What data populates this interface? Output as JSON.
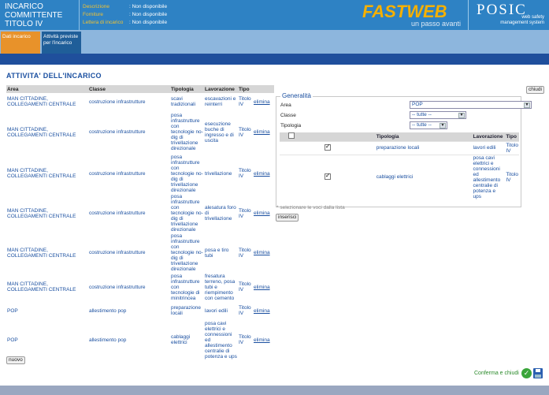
{
  "header": {
    "title_lines": [
      "INCARICO",
      "COMMITTENTE",
      "TITOLO IV"
    ],
    "meta": [
      {
        "label": "Descrizione",
        "value": ": Non disponibile"
      },
      {
        "label": "Forniture",
        "value": ": Non disponibile"
      },
      {
        "label": "Lettera di incarico",
        "value": ": Non disponibile"
      }
    ],
    "logo_word": "FASTWEB",
    "logo_slogan": "un passo avanti",
    "posic_name": "POSIC",
    "posic_sub_1": "web safety",
    "posic_sub_2": "management system"
  },
  "tabs": [
    {
      "label": "Dati incarico"
    },
    {
      "label": "Attività previste per l'incarico"
    }
  ],
  "page_title": "ATTIVITA' DELL'INCARICO",
  "activities": {
    "headers": [
      "Area",
      "Classe",
      "Tipologia",
      "Lavorazione",
      "Tipo",
      ""
    ],
    "rows": [
      {
        "area": "MAN CITTADINE, COLLEGAMENTI CENTRALE",
        "classe": "costruzione infrastrutture",
        "tipologia": "scavi tradizionali",
        "lavorazione": "escavazioni e reinterri",
        "tipo": "Titolo IV",
        "azione": "elimina"
      },
      {
        "area": "MAN CITTADINE, COLLEGAMENTI CENTRALE",
        "classe": "costruzione infrastrutture",
        "tipologia": "posa infrastrutture con tecnologie no-dig di trivellazione direzionale",
        "lavorazione": "esecuzione buche di ingresso e di uscita",
        "tipo": "Titolo IV",
        "azione": "elimina"
      },
      {
        "area": "MAN CITTADINE, COLLEGAMENTI CENTRALE",
        "classe": "costruzione infrastrutture",
        "tipologia": "posa infrastrutture con tecnologie no-dig di trivellazione direzionale",
        "lavorazione": "trivellazione",
        "tipo": "Titolo IV",
        "azione": "elimina"
      },
      {
        "area": "MAN CITTADINE, COLLEGAMENTI CENTRALE",
        "classe": "costruzione infrastrutture",
        "tipologia": "posa infrastrutture con tecnologie no-dig di trivellazione direzionale",
        "lavorazione": "alesatura foro di trivellazione",
        "tipo": "Titolo IV",
        "azione": "elimina"
      },
      {
        "area": "MAN CITTADINE, COLLEGAMENTI CENTRALE",
        "classe": "costruzione infrastrutture",
        "tipologia": "posa infrastrutture con tecnologie no-dig di trivellazione direzionale",
        "lavorazione": "posa e tiro tubi",
        "tipo": "Titolo IV",
        "azione": "elimina"
      },
      {
        "area": "MAN CITTADINE, COLLEGAMENTI CENTRALE",
        "classe": "costruzione infrastrutture",
        "tipologia": "posa infrastrutture con tecnologie di minitrincea",
        "lavorazione": "fresatura terreno, posa tubi e riempimento con cemento",
        "tipo": "Titolo IV",
        "azione": "elimina"
      },
      {
        "area": "POP",
        "classe": "allestimento pop",
        "tipologia": "preparazione locali",
        "lavorazione": "lavori edili",
        "tipo": "Titolo IV",
        "azione": "elimina"
      },
      {
        "area": "POP",
        "classe": "allestimento pop",
        "tipologia": "cablaggi elettrici",
        "lavorazione": "posa cavi elettrici e connessioni ed allestimento centralie di potenza e ups",
        "tipo": "Titolo IV",
        "azione": "elimina"
      }
    ]
  },
  "buttons": {
    "nuovo": "nuovo",
    "chiudi": "chiudi",
    "inserisci": "inserisci"
  },
  "generalita": {
    "legend": "Generalità",
    "area_label": "Area",
    "area_value": "POP",
    "classe_label": "Classe",
    "classe_value": "-- tutte --",
    "tipologia_label": "Tipologia",
    "tipologia_value": "-- tutte --",
    "table": {
      "headers": [
        "",
        "Tipologia",
        "Lavorazione",
        "Tipo"
      ],
      "rows": [
        {
          "checked": true,
          "tipologia": "preparazione locali",
          "lavorazione": "lavori edili",
          "tipo": "Titolo IV"
        },
        {
          "checked": true,
          "tipologia": "cablaggi elettrici",
          "lavorazione": "posa cavi elettrici e connessioni ed allestimento centralie di potenza e ups",
          "tipo": "Titolo IV"
        }
      ]
    },
    "note": "* selezionare le voci dalla lista"
  },
  "confirm_label": "Conferma e chiudi",
  "colors": {
    "header_blue": "#2e82c4",
    "tab_active": "#e8922a",
    "band_blue": "#1f4f9c",
    "link_blue": "#1a4fa0"
  }
}
